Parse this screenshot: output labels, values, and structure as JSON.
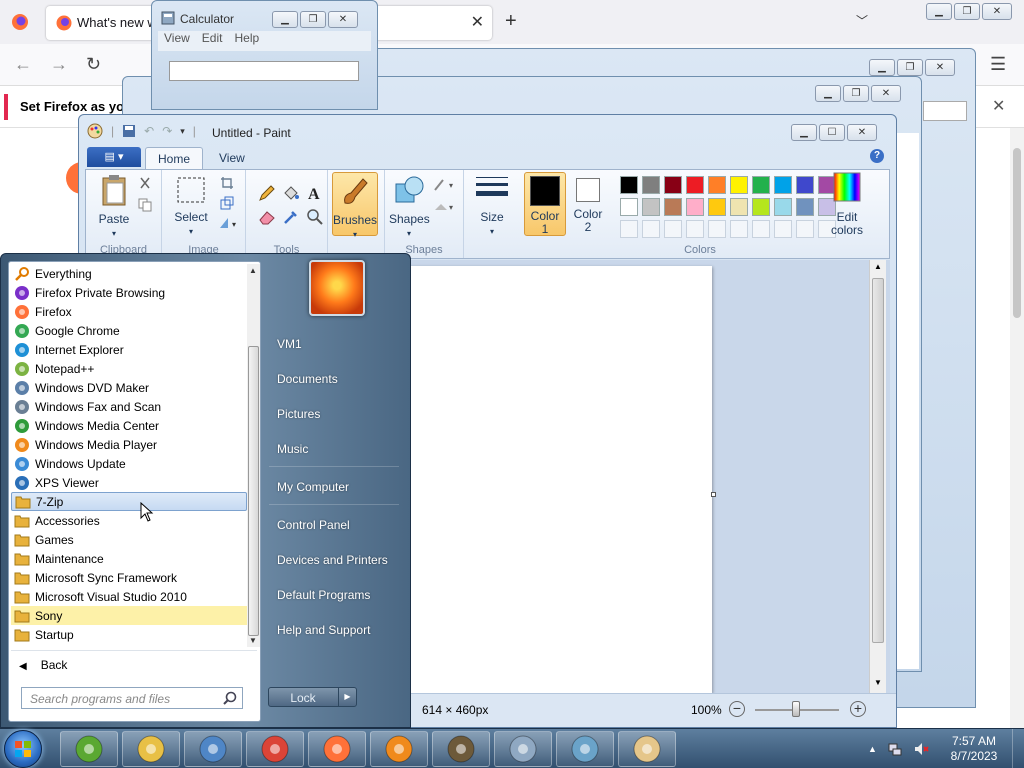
{
  "firefox": {
    "tab_title": "What's new w",
    "notification": "Set Firefox as your"
  },
  "calculator": {
    "title": "Calculator",
    "menu": [
      "View",
      "Edit",
      "Help"
    ]
  },
  "paint": {
    "title": "Untitled - Paint",
    "tabs": {
      "home": "Home",
      "view": "View"
    },
    "buttons": {
      "paste": "Paste",
      "select": "Select",
      "brushes": "Brushes",
      "shapes": "Shapes",
      "size": "Size",
      "color1_a": "Color",
      "color1_b": "1",
      "color2_a": "Color",
      "color2_b": "2",
      "edit_colors_a": "Edit",
      "edit_colors_b": "colors"
    },
    "groups": {
      "clipboard": "Clipboard",
      "image": "Image",
      "tools": "Tools",
      "shapes": "Shapes",
      "colors": "Colors"
    },
    "palette_row1": [
      "#000000",
      "#7f7f7f",
      "#880015",
      "#ed1c24",
      "#ff7f27",
      "#fff200",
      "#22b14c",
      "#00a2e8",
      "#3f48cc",
      "#a349a4"
    ],
    "palette_row2": [
      "#ffffff",
      "#c3c3c3",
      "#b97a57",
      "#ffaec9",
      "#ffc90e",
      "#efe4b0",
      "#b5e61d",
      "#99d9ea",
      "#7092be",
      "#c8bfe7"
    ],
    "color1": "#000000",
    "color2": "#ffffff",
    "status": {
      "dimensions": "614 × 460px",
      "zoom": "100%"
    }
  },
  "start_menu": {
    "programs": [
      {
        "label": "Everything",
        "icon": "magnifier-icon",
        "color": "#e07b00"
      },
      {
        "label": "Firefox Private Browsing",
        "icon": "private-mask-icon",
        "color": "#7a2fc9"
      },
      {
        "label": "Firefox",
        "icon": "firefox-icon",
        "color": "#ff7139"
      },
      {
        "label": "Google Chrome",
        "icon": "chrome-icon",
        "color": "#34a853"
      },
      {
        "label": "Internet Explorer",
        "icon": "ie-icon",
        "color": "#1e90d6"
      },
      {
        "label": "Notepad++",
        "icon": "notepad-icon",
        "color": "#7cb342"
      },
      {
        "label": "Windows DVD Maker",
        "icon": "dvd-icon",
        "color": "#5b7fa8"
      },
      {
        "label": "Windows Fax and Scan",
        "icon": "fax-icon",
        "color": "#6a7f94"
      },
      {
        "label": "Windows Media Center",
        "icon": "media-center-icon",
        "color": "#2e9b3a"
      },
      {
        "label": "Windows Media Player",
        "icon": "media-player-icon",
        "color": "#f08a1c"
      },
      {
        "label": "Windows Update",
        "icon": "update-icon",
        "color": "#3a8bd6"
      },
      {
        "label": "XPS Viewer",
        "icon": "xps-icon",
        "color": "#2a6fb8"
      },
      {
        "label": "7-Zip",
        "icon": "folder-icon",
        "color": "#e8b23c"
      },
      {
        "label": "Accessories",
        "icon": "folder-icon",
        "color": "#e8b23c"
      },
      {
        "label": "Games",
        "icon": "folder-icon",
        "color": "#e8b23c"
      },
      {
        "label": "Maintenance",
        "icon": "folder-icon",
        "color": "#e8b23c"
      },
      {
        "label": "Microsoft Sync Framework",
        "icon": "folder-icon",
        "color": "#e8b23c"
      },
      {
        "label": "Microsoft Visual Studio 2010",
        "icon": "folder-icon",
        "color": "#e8b23c"
      },
      {
        "label": "Sony",
        "icon": "folder-icon",
        "color": "#e8b23c"
      },
      {
        "label": "Startup",
        "icon": "folder-icon",
        "color": "#e8b23c"
      }
    ],
    "selected": "7-Zip",
    "highlighted": "Sony",
    "back": "Back",
    "search_placeholder": "Search programs and files",
    "right_items": [
      "VM1",
      "Documents",
      "Pictures",
      "Music",
      "My Computer",
      "Control Panel",
      "Devices and Printers",
      "Default Programs",
      "Help and Support"
    ],
    "lock": "Lock"
  },
  "taskbar": {
    "apps": [
      "utorrent-icon",
      "file-explorer-icon",
      "wordpad-icon",
      "chrome-icon",
      "firefox-icon",
      "everything-icon",
      "media-app-icon",
      "calculator-icon",
      "document-icon",
      "paint-icon"
    ],
    "time": "7:57 AM",
    "date": "8/7/2023"
  }
}
